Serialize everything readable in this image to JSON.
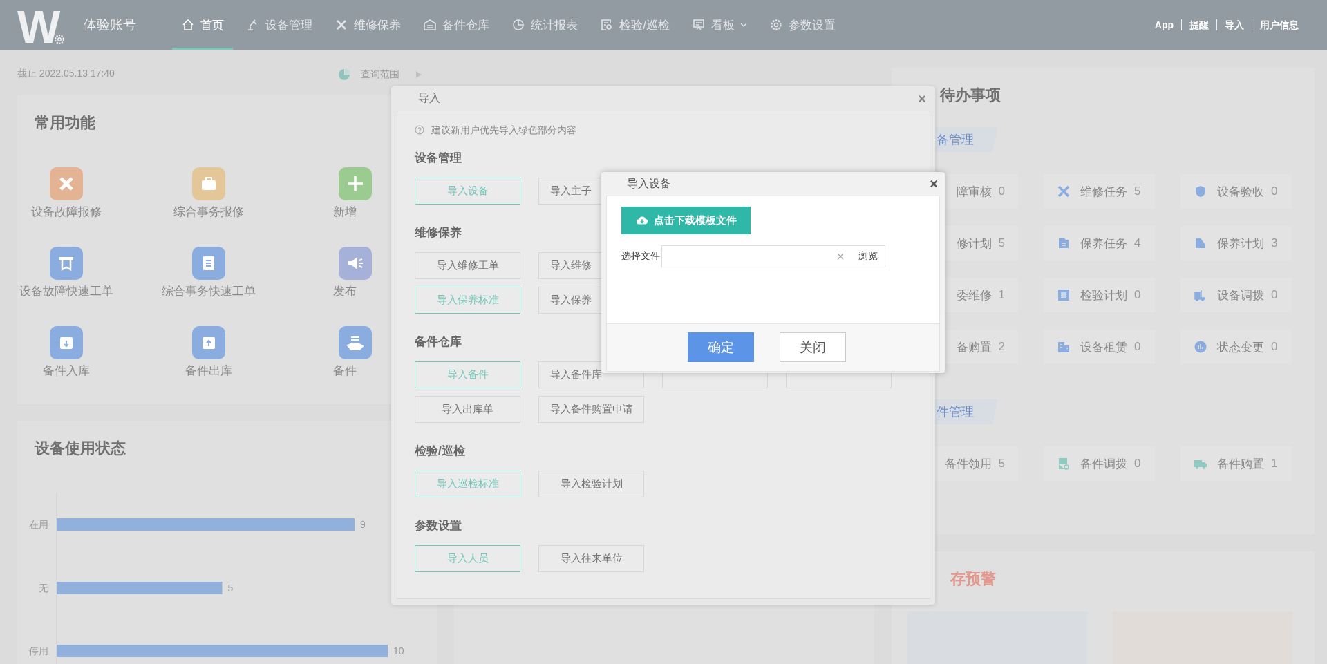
{
  "header": {
    "logo": "W",
    "account": "体验账号",
    "nav": [
      {
        "label": "首页",
        "selected": true,
        "dropdown": false
      },
      {
        "label": "设备管理",
        "selected": false,
        "dropdown": false
      },
      {
        "label": "维修保养",
        "selected": false,
        "dropdown": false
      },
      {
        "label": "备件仓库",
        "selected": false,
        "dropdown": false
      },
      {
        "label": "统计报表",
        "selected": false,
        "dropdown": false
      },
      {
        "label": "检验/巡检",
        "selected": false,
        "dropdown": false
      },
      {
        "label": "看板",
        "selected": false,
        "dropdown": true
      },
      {
        "label": "参数设置",
        "selected": false,
        "dropdown": false
      }
    ],
    "links": [
      "App",
      "提醒",
      "导入",
      "用户信息"
    ]
  },
  "deadline": "截止 2022.05.13 17:40",
  "query_range": "查询范围",
  "common_functions": {
    "title": "常用功能",
    "items": [
      {
        "label": "设备故障报修",
        "color": "#e3b394"
      },
      {
        "label": "综合事务报修",
        "color": "#e3c799"
      },
      {
        "label": "新增",
        "color": "#9ccb92"
      },
      {
        "label": "设备故障快速工单",
        "color": "#8aacdf"
      },
      {
        "label": "综合事务快速工单",
        "color": "#8aacdf"
      },
      {
        "label": "发布",
        "color": "#a6b1da"
      },
      {
        "label": "备件入库",
        "color": "#8aacdf"
      },
      {
        "label": "备件出库",
        "color": "#8aacdf"
      },
      {
        "label": "备件",
        "color": "#8aacdf"
      }
    ]
  },
  "usage_status": {
    "title": "设备使用状态",
    "chart_data": {
      "type": "bar",
      "orientation": "horizontal",
      "categories": [
        "在用",
        "无",
        "停用"
      ],
      "values": [
        9,
        5,
        10
      ],
      "data_labels": true
    }
  },
  "todo": {
    "title": "待办事项",
    "groups": [
      {
        "tag": "备管理",
        "items": [
          {
            "label": "障审核",
            "count": "0"
          },
          {
            "label": "维修任务",
            "count": "5"
          },
          {
            "label": "设备验收",
            "count": "0"
          },
          {
            "label": "修计划",
            "count": "5"
          },
          {
            "label": "保养任务",
            "count": "4"
          },
          {
            "label": "保养计划",
            "count": "3"
          },
          {
            "label": "委维修",
            "count": "1"
          },
          {
            "label": "检验计划",
            "count": "0"
          },
          {
            "label": "设备调拨",
            "count": "0"
          },
          {
            "label": "备购置",
            "count": "2"
          },
          {
            "label": "设备租赁",
            "count": "0"
          },
          {
            "label": "状态变更",
            "count": "0"
          }
        ]
      },
      {
        "tag": "件管理",
        "items": [
          {
            "label": "备件领用",
            "count": "5"
          },
          {
            "label": "备件调拨",
            "count": "0"
          },
          {
            "label": "备件购置",
            "count": "1"
          }
        ]
      }
    ]
  },
  "stock_warning": {
    "title": "存预警"
  },
  "import_dialog": {
    "title": "导入",
    "close": "×",
    "hint": "建议新用户优先导入绿色部分内容",
    "sections": [
      {
        "title": "设备管理",
        "rows": [
          [
            {
              "label": "导入设备",
              "recommended": true
            },
            {
              "label": "导入主子",
              "recommended": false
            }
          ]
        ]
      },
      {
        "title": "维修保养",
        "rows": [
          [
            {
              "label": "导入维修工单",
              "recommended": false
            },
            {
              "label": "导入维修",
              "recommended": false
            }
          ],
          [
            {
              "label": "导入保养标准",
              "recommended": true
            },
            {
              "label": "导入保养",
              "recommended": false
            }
          ]
        ]
      },
      {
        "title": "备件仓库",
        "rows": [
          [
            {
              "label": "导入备件",
              "recommended": true
            },
            {
              "label": "导入备件库",
              "recommended": false
            },
            {
              "recommended": false
            },
            {
              "recommended": false
            }
          ],
          [
            {
              "label": "导入出库单",
              "recommended": false
            },
            {
              "label": "导入备件购置申请",
              "recommended": false
            }
          ]
        ]
      },
      {
        "title": "检验/巡检",
        "rows": [
          [
            {
              "label": "导入巡检标准",
              "recommended": true
            },
            {
              "label": "导入检验计划",
              "recommended": false
            }
          ]
        ]
      },
      {
        "title": "参数设置",
        "rows": [
          [
            {
              "label": "导入人员",
              "recommended": true
            },
            {
              "label": "导入往来单位",
              "recommended": false
            }
          ]
        ]
      }
    ]
  },
  "import_device_dialog": {
    "title": "导入设备",
    "close": "×",
    "download": "点击下载模板文件",
    "file_label": "选择文件",
    "clear": "×",
    "browse": "浏览",
    "confirm": "确定",
    "cancel": "关闭"
  }
}
